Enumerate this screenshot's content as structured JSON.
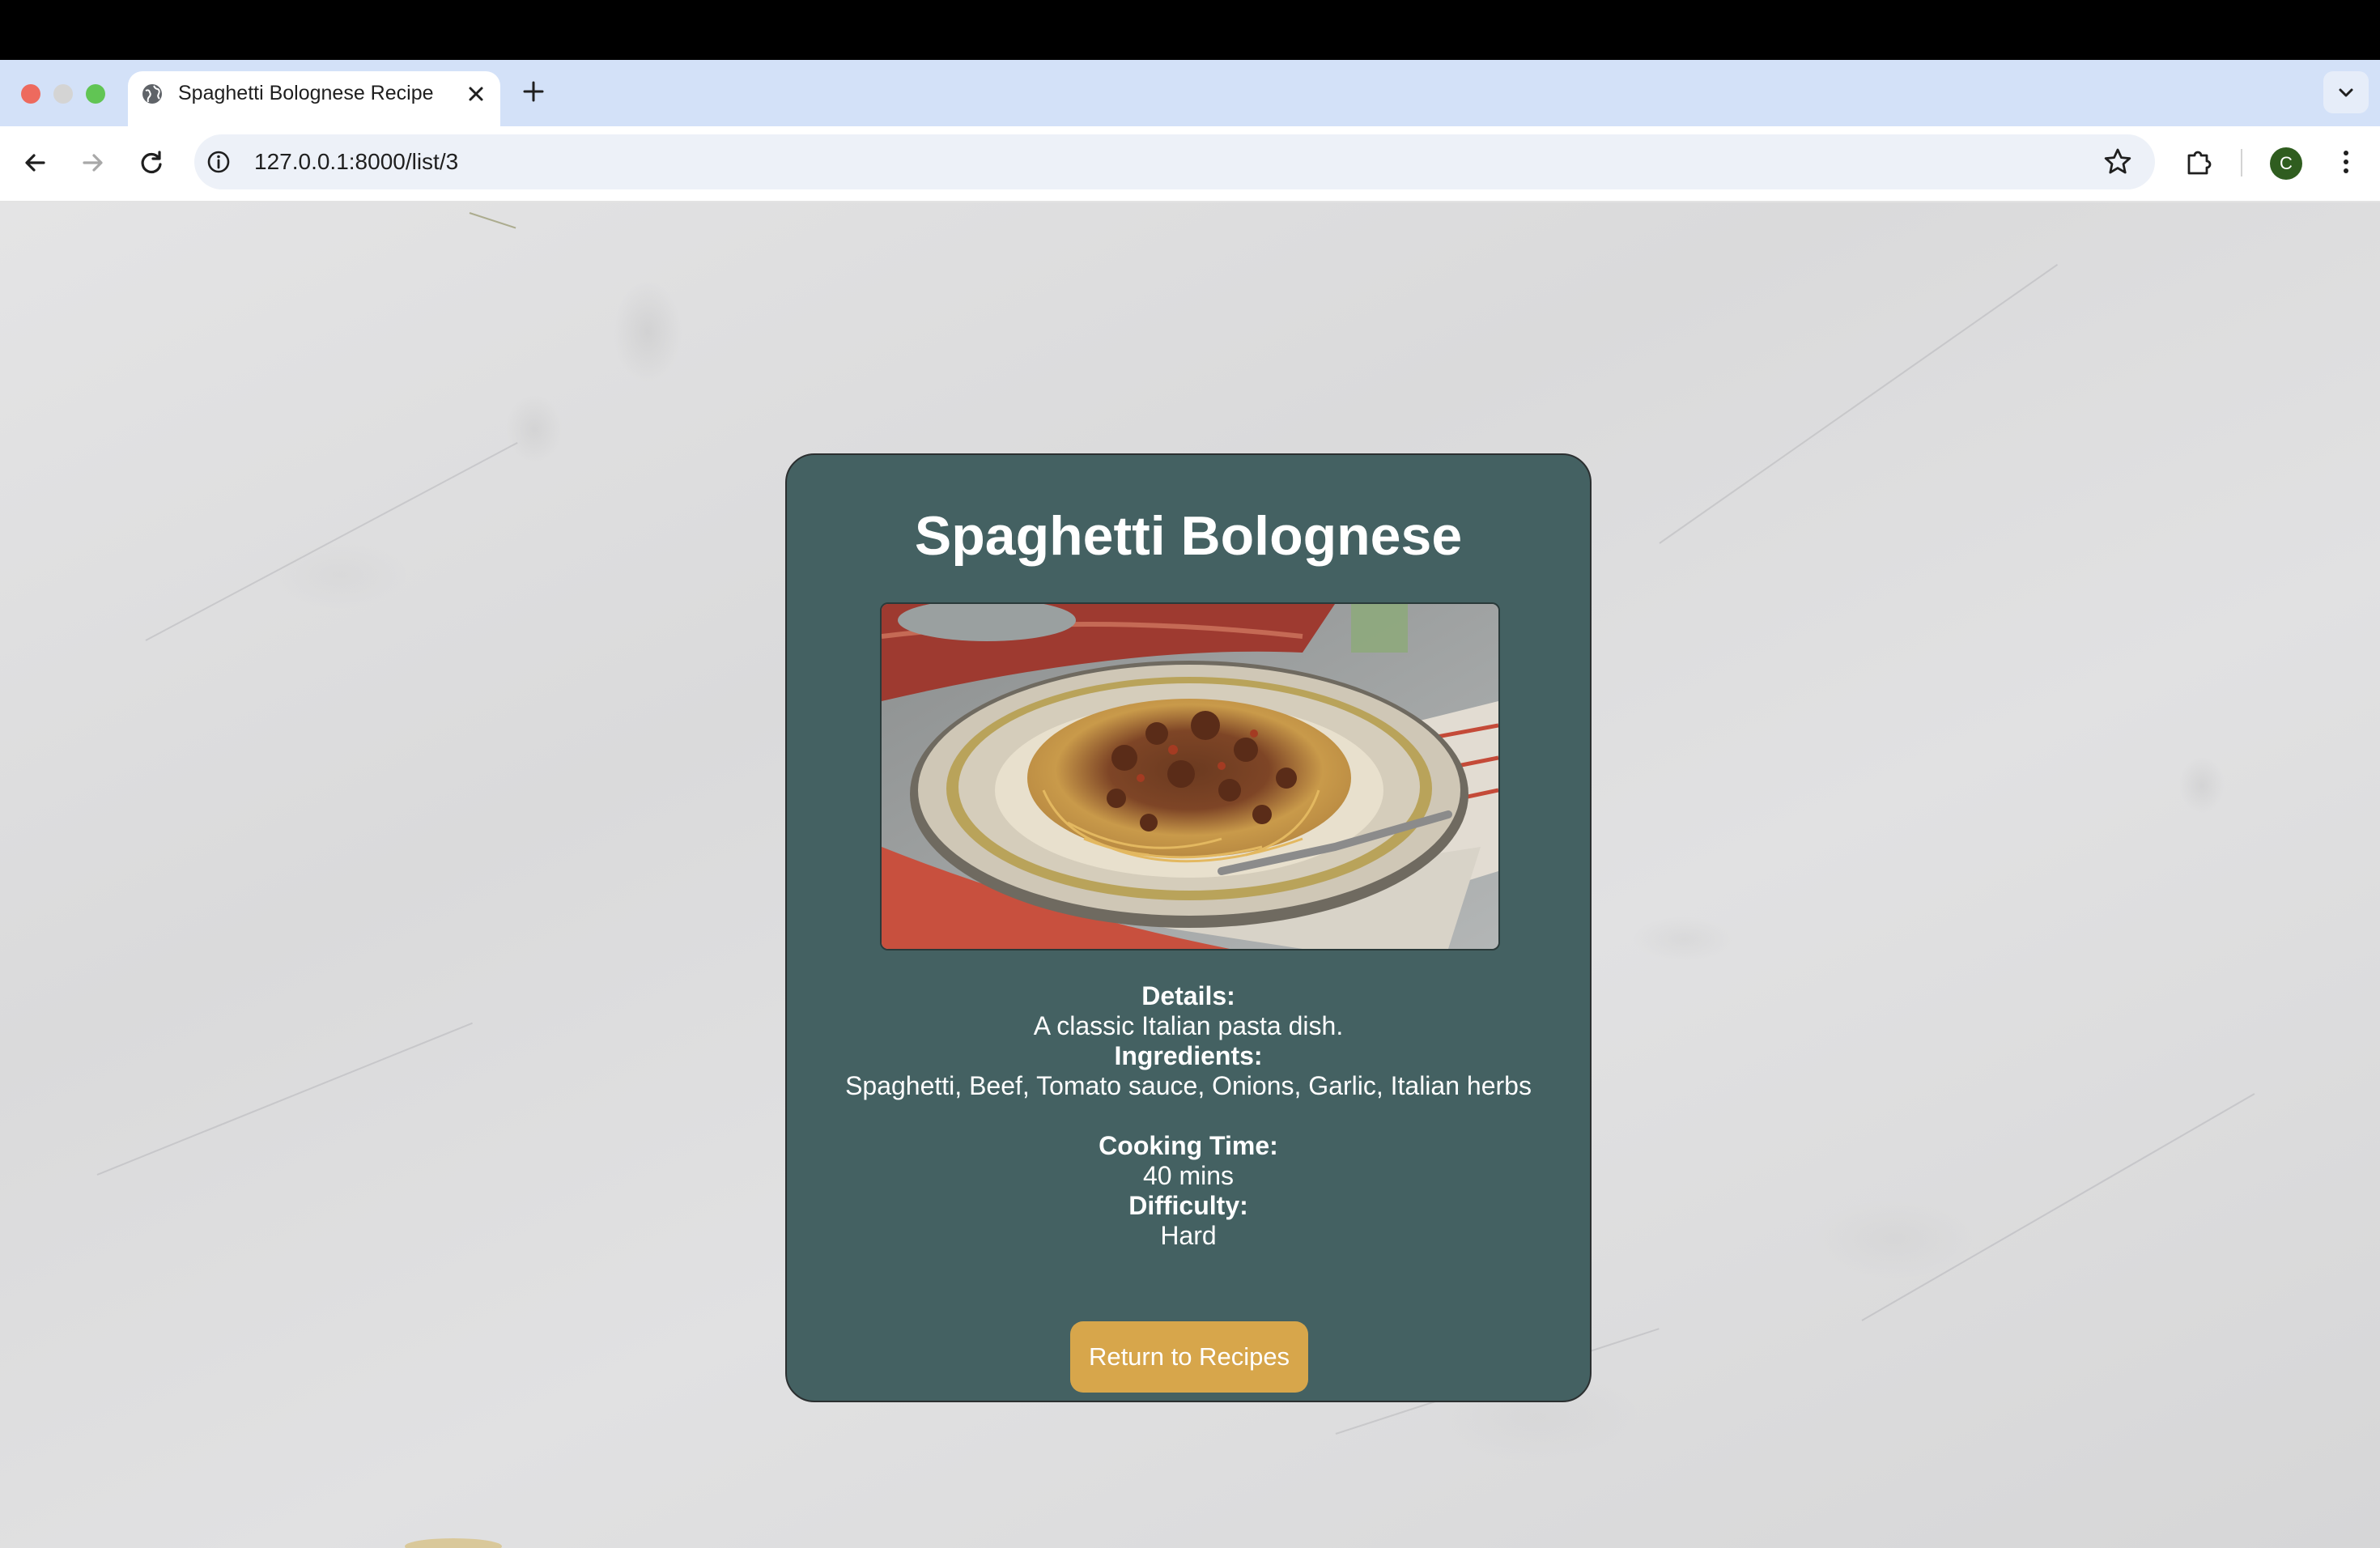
{
  "browser": {
    "tab_title": "Spaghetti Bolognese Recipe",
    "url": "127.0.0.1:8000/list/3",
    "profile_initial": "C"
  },
  "recipe": {
    "title": "Spaghetti Bolognese",
    "details_label": "Details:",
    "details": "A classic Italian pasta dish.",
    "ingredients_label": "Ingredients:",
    "ingredients": "Spaghetti, Beef, Tomato sauce, Onions, Garlic, Italian herbs",
    "cooking_time_label": "Cooking Time:",
    "cooking_time": "40 mins",
    "difficulty_label": "Difficulty:",
    "difficulty": "Hard",
    "return_button": "Return to Recipes"
  },
  "colors": {
    "card": "#446162",
    "button": "#d7a64b",
    "tab_strip": "#d3e1f8"
  },
  "icons": {
    "tab_favicon": "globe-icon",
    "tab_close": "close-icon",
    "new_tab": "plus-icon",
    "tab_menu": "chevron-down-icon",
    "back": "arrow-left-icon",
    "forward": "arrow-right-icon",
    "reload": "reload-icon",
    "site_info": "info-icon",
    "bookmark": "star-icon",
    "extensions": "puzzle-icon",
    "menu": "kebab-menu-icon"
  }
}
